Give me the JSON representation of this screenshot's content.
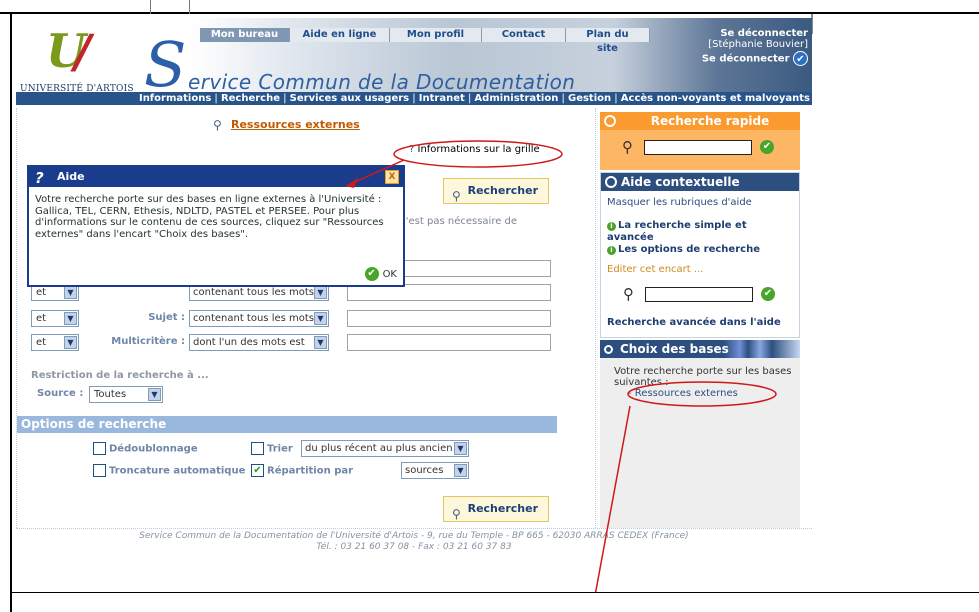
{
  "header": {
    "university_name": "UNIVERSITÉ D'ARTOIS",
    "service_title": "ervice Commun de la Documentation",
    "service_initial": "S",
    "top_nav": [
      "Mon bureau",
      "Aide en ligne",
      "Mon profil",
      "Contact",
      "Plan du site"
    ],
    "logout": {
      "title": "Se déconnecter",
      "user": "[Stéphanie Bouvier]",
      "action": "Se déconnecter"
    },
    "main_nav": [
      "Informations",
      "Recherche",
      "Services aux usagers",
      "Intranet",
      "Administration",
      "Gestion",
      "Accès non-voyants et malvoyants"
    ]
  },
  "content": {
    "page_title": "Ressources externes",
    "info_link": "Informations sur la grille",
    "search_button": "Rechercher",
    "partial_text": "l'est pas nécessaire de",
    "rows": [
      {
        "operator": "et",
        "label": "",
        "mode": "contenant tous les mots"
      },
      {
        "operator": "et",
        "label": "Sujet :",
        "mode": "contenant tous les mots"
      },
      {
        "operator": "et",
        "label": "Multicritère :",
        "mode": "dont l'un des mots est"
      }
    ],
    "restriction_label": "Restriction de la recherche à ...",
    "source_label": "Source :",
    "source_value": "Toutes",
    "options_header": "Options de recherche",
    "options": {
      "dedup": "Dédoublonnage",
      "sort": "Trier",
      "sort_value": "du plus récent au plus ancien",
      "truncation": "Troncature automatique",
      "distribution": "Répartition par",
      "distribution_value": "sources"
    }
  },
  "dialog": {
    "title": "Aide",
    "body": "Votre recherche porte sur des bases en ligne externes à l'Université : Gallica, TEL, CERN, Ethesis, NDLTD, PASTEL et PERSEE. Pour plus d'informations sur le contenu de ces sources, cliquez sur \"Ressources externes\" dans l'encart \"Choix des bases\".",
    "ok": "OK",
    "close": "X"
  },
  "quick_search": {
    "title": "Recherche rapide"
  },
  "context_help": {
    "title": "Aide contextuelle",
    "hide": "Masquer les rubriques d'aide",
    "link1": "La recherche simple et avancée",
    "link2": "Les options de recherche",
    "edit": "Editer cet encart ...",
    "advanced": "Recherche avancée dans l'aide"
  },
  "bases": {
    "title": "Choix des bases",
    "text": "Votre recherche porte sur les bases suivantes :",
    "item": "- Ressources externes"
  },
  "footer": {
    "line1": "Service Commun de la Documentation de l'Université d'Artois - 9, rue du Temple - BP 665 - 62030 ARRAS CEDEX (France)",
    "line2": "Tél. : 03 21 60 37 08 - Fax : 03 21 60 37 83"
  },
  "colors": {
    "nav_blue": "#29548a",
    "accent_orange": "#fb9a2f",
    "annotation_red": "#d01818"
  }
}
